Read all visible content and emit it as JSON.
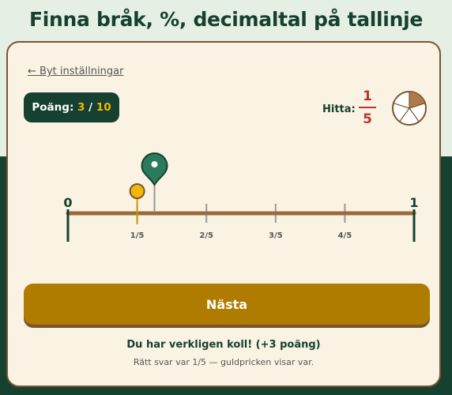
{
  "header": {
    "title": "Finna bråk, %, decimaltal på tallinje"
  },
  "back_link": "← Byt inställningar",
  "score": {
    "label": "Poäng:",
    "current": "3",
    "separator": "/",
    "total": "10"
  },
  "target": {
    "label": "Hitta:",
    "numerator": "1",
    "denominator": "5"
  },
  "number_line": {
    "start_label": "0",
    "end_label": "1",
    "ticks": [
      "1/5",
      "2/5",
      "3/5",
      "4/5"
    ],
    "correct_value": 0.2,
    "guess_value": 0.25
  },
  "colors": {
    "dark_green": "#16402f",
    "gold": "#f2b705",
    "brown": "#9b6a3c",
    "marker_green": "#2a7a5c",
    "button": "#b07c00"
  },
  "next_button": {
    "label": "Nästa"
  },
  "feedback": {
    "message": "Du har verkligen koll! (+3 poäng)",
    "detail": "Rätt svar var 1/5 — guldpricken visar var."
  }
}
